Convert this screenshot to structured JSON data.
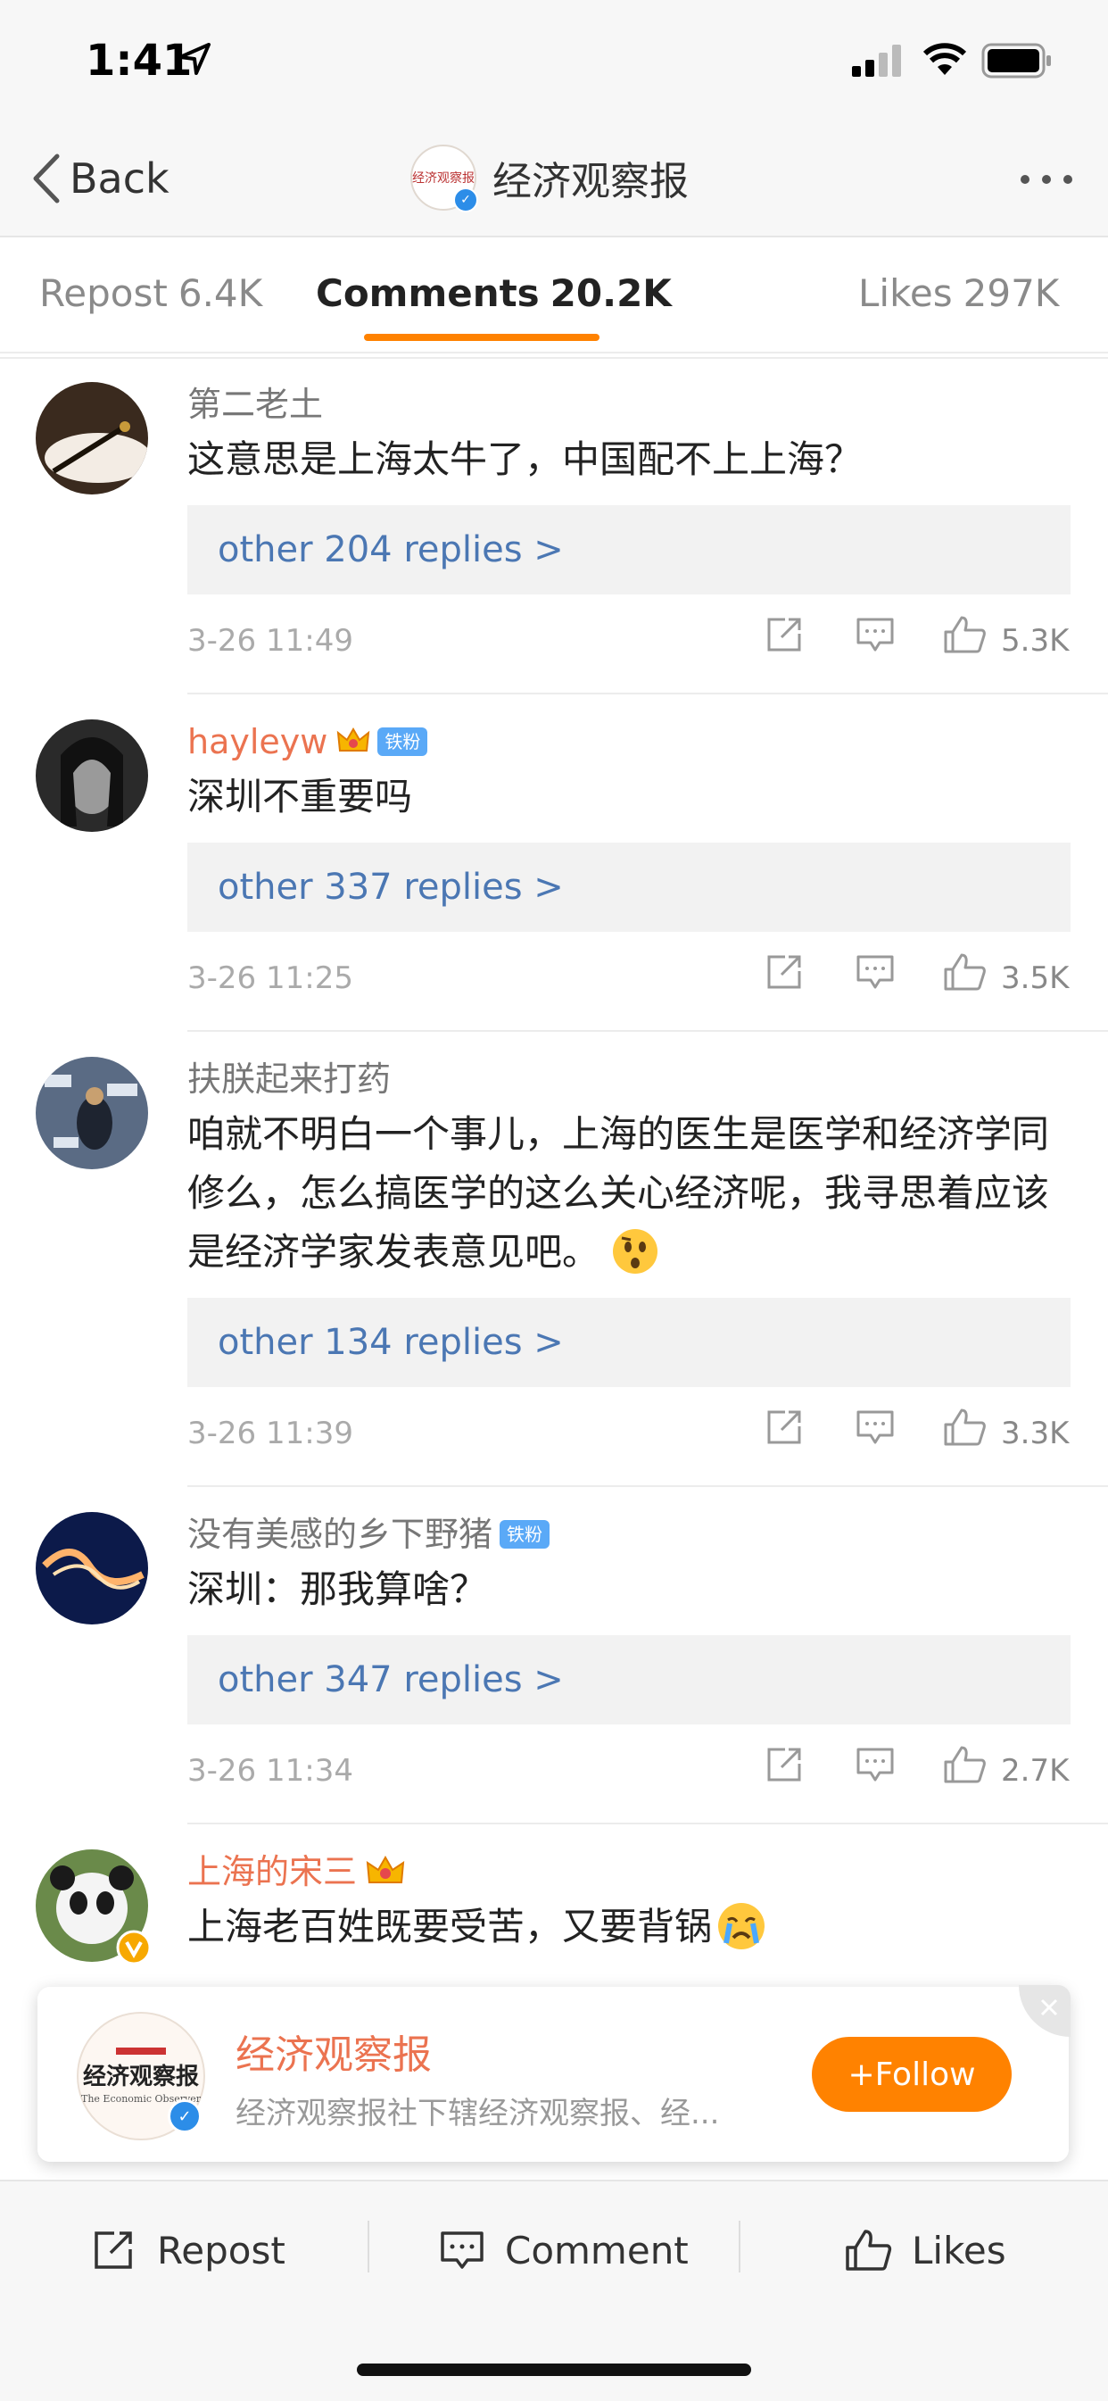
{
  "status_bar": {
    "time": "1:41"
  },
  "nav": {
    "back_label": "Back",
    "title": "经济观察报"
  },
  "tabs": [
    {
      "label": "Repost",
      "count": "6.4K"
    },
    {
      "label": "Comments",
      "count": "20.2K"
    },
    {
      "label": "Likes",
      "count": "297K"
    }
  ],
  "comments": [
    {
      "user": "第二老土",
      "text": "这意思是上海太牛了，中国配不上上海？",
      "replies": "other 204 replies >",
      "time": "3-26 11:49",
      "likes": "5.3K"
    },
    {
      "user": "hayleyw",
      "badge": "铁粉",
      "text": "深圳不重要吗",
      "replies": "other 337 replies >",
      "time": "3-26 11:25",
      "likes": "3.5K"
    },
    {
      "user": "扶朕起来打药",
      "text": "咱就不明白一个事儿，上海的医生是医学和经济学同修么，怎么搞医学的这么关心经济呢，我寻思着应该是经济学家发表意见吧。",
      "replies": "other 134 replies >",
      "time": "3-26 11:39",
      "likes": "3.3K"
    },
    {
      "user": "没有美感的乡下野猪",
      "badge": "铁粉",
      "text": "深圳：那我算啥？",
      "replies": "other 347 replies >",
      "time": "3-26 11:34",
      "likes": "2.7K"
    },
    {
      "user": "上海的宋三",
      "text": "上海老百姓既要受苦，又要背锅"
    }
  ],
  "follow_card": {
    "name": "经济观察报",
    "description": "经济观察报社下辖经济观察报、经...",
    "follow_label": "+Follow",
    "logo_text": "经济观察报",
    "logo_sub": "The Economic Observer"
  },
  "bottom_bar": {
    "repost": "Repost",
    "comment": "Comment",
    "likes": "Likes"
  },
  "colors": {
    "accent": "#ff8200",
    "link": "#4b77b3",
    "vip_name": "#eb7350",
    "fan_badge": "#5aa9f7"
  }
}
